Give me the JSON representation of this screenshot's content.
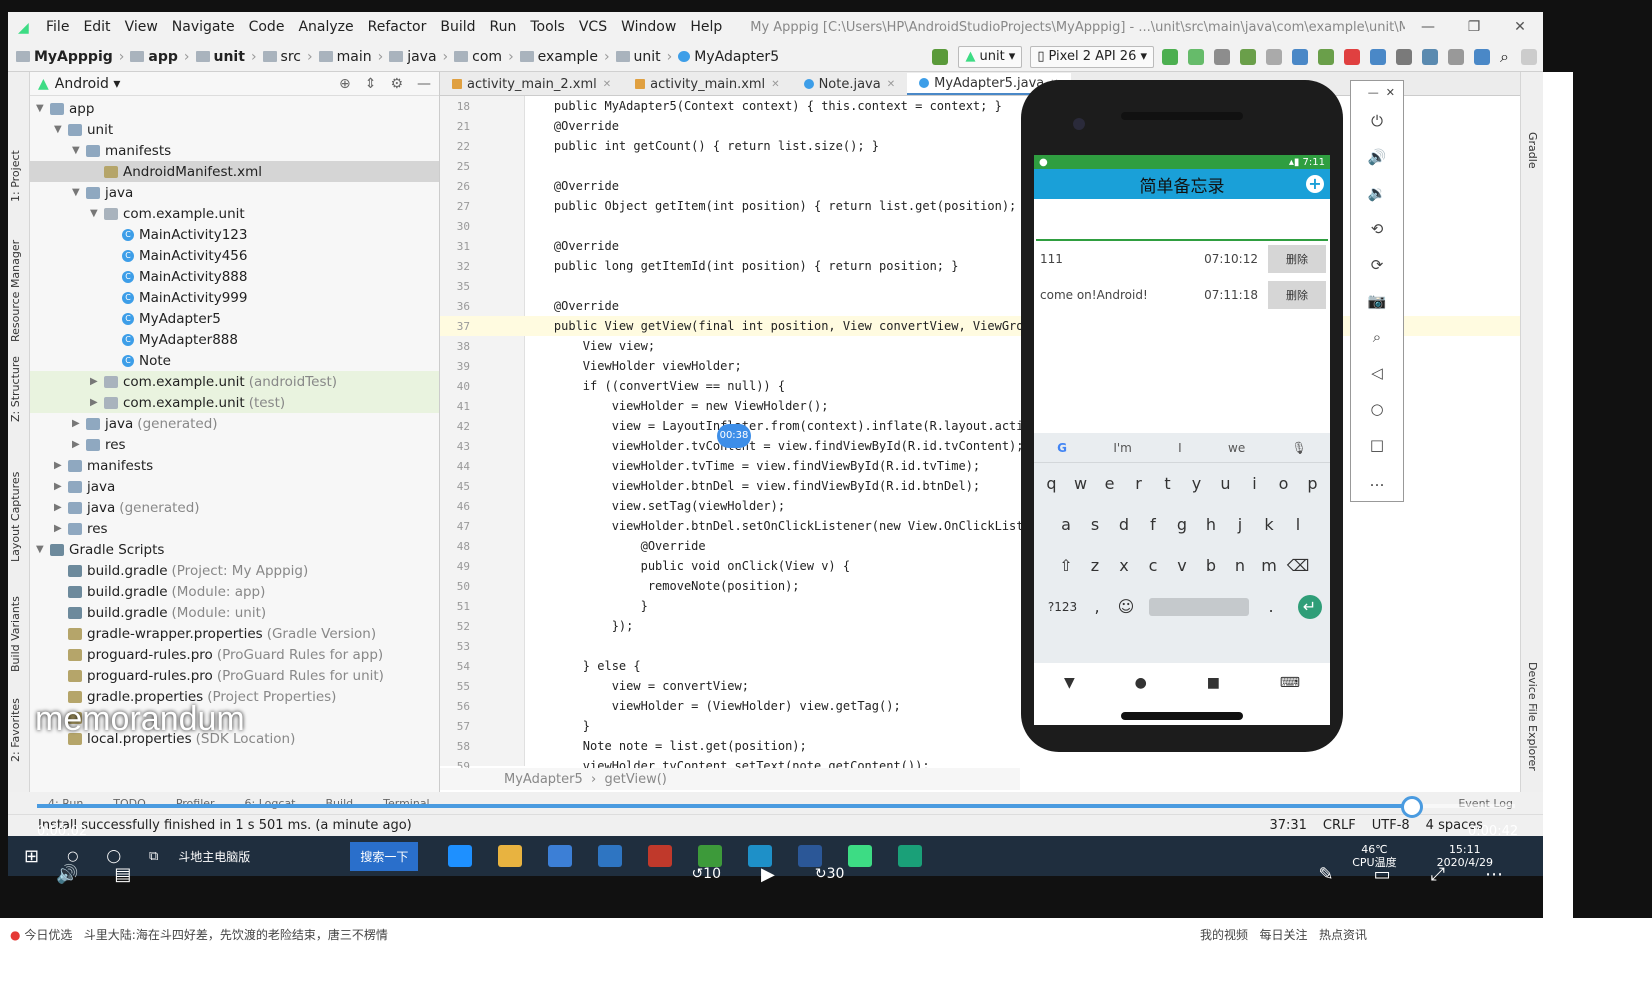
{
  "menu": {
    "items": [
      "File",
      "Edit",
      "View",
      "Navigate",
      "Code",
      "Analyze",
      "Refactor",
      "Build",
      "Run",
      "Tools",
      "VCS",
      "Window",
      "Help"
    ],
    "title": "My Apppig [C:\\Users\\HP\\AndroidStudioProjects\\MyApppig] - ...\\unit\\src\\main\\java\\com\\example\\unit\\MyAdapter5.java [unit]"
  },
  "nav": {
    "crumbs": [
      "MyApppig",
      "app",
      "unit",
      "src",
      "main",
      "java",
      "com",
      "example",
      "unit",
      "MyAdapter5"
    ],
    "config": "unit",
    "device": "Pixel 2 API 26"
  },
  "left_strip": [
    "1: Project",
    "Resource Manager",
    "Z: Structure",
    "Layout Captures",
    "Build Variants",
    "2: Favorites"
  ],
  "project": {
    "view": "Android",
    "tree": [
      {
        "label": "app",
        "d": 0,
        "arrow": "▼",
        "icon": "folder"
      },
      {
        "label": "unit",
        "d": 1,
        "arrow": "▼",
        "icon": "folder"
      },
      {
        "label": "manifests",
        "d": 2,
        "arrow": "▼",
        "icon": "folder"
      },
      {
        "label": "AndroidManifest.xml",
        "d": 3,
        "arrow": "",
        "icon": "file",
        "sel": true
      },
      {
        "label": "java",
        "d": 2,
        "arrow": "▼",
        "icon": "folder"
      },
      {
        "label": "com.example.unit",
        "d": 3,
        "arrow": "▼",
        "icon": "pkg"
      },
      {
        "label": "MainActivity123",
        "d": 4,
        "arrow": "",
        "icon": "class"
      },
      {
        "label": "MainActivity456",
        "d": 4,
        "arrow": "",
        "icon": "class"
      },
      {
        "label": "MainActivity888",
        "d": 4,
        "arrow": "",
        "icon": "class"
      },
      {
        "label": "MainActivity999",
        "d": 4,
        "arrow": "",
        "icon": "class"
      },
      {
        "label": "MyAdapter5",
        "d": 4,
        "arrow": "",
        "icon": "class"
      },
      {
        "label": "MyAdapter888",
        "d": 4,
        "arrow": "",
        "icon": "class"
      },
      {
        "label": "Note",
        "d": 4,
        "arrow": "",
        "icon": "class"
      },
      {
        "label": "com.example.unit",
        "note": "(androidTest)",
        "d": 3,
        "arrow": "▶",
        "icon": "pkg",
        "test": true
      },
      {
        "label": "com.example.unit",
        "note": "(test)",
        "d": 3,
        "arrow": "▶",
        "icon": "pkg",
        "test": true
      },
      {
        "label": "java",
        "note": "(generated)",
        "d": 2,
        "arrow": "▶",
        "icon": "folder"
      },
      {
        "label": "res",
        "d": 2,
        "arrow": "▶",
        "icon": "folder"
      },
      {
        "label": "manifests",
        "d": 1,
        "arrow": "▶",
        "icon": "folder"
      },
      {
        "label": "java",
        "d": 1,
        "arrow": "▶",
        "icon": "folder"
      },
      {
        "label": "java",
        "note": "(generated)",
        "d": 1,
        "arrow": "▶",
        "icon": "folder"
      },
      {
        "label": "res",
        "d": 1,
        "arrow": "▶",
        "icon": "folder"
      },
      {
        "label": "Gradle Scripts",
        "d": 0,
        "arrow": "▼",
        "icon": "gradle"
      },
      {
        "label": "build.gradle",
        "note": "(Project: My Apppig)",
        "d": 1,
        "arrow": "",
        "icon": "gradle"
      },
      {
        "label": "build.gradle",
        "note": "(Module: app)",
        "d": 1,
        "arrow": "",
        "icon": "gradle"
      },
      {
        "label": "build.gradle",
        "note": "(Module: unit)",
        "d": 1,
        "arrow": "",
        "icon": "gradle"
      },
      {
        "label": "gradle-wrapper.properties",
        "note": "(Gradle Version)",
        "d": 1,
        "arrow": "",
        "icon": "file"
      },
      {
        "label": "proguard-rules.pro",
        "note": "(ProGuard Rules for app)",
        "d": 1,
        "arrow": "",
        "icon": "file"
      },
      {
        "label": "proguard-rules.pro",
        "note": "(ProGuard Rules for unit)",
        "d": 1,
        "arrow": "",
        "icon": "file"
      },
      {
        "label": "gradle.properties",
        "note": "(Project Properties)",
        "d": 1,
        "arrow": "",
        "icon": "file"
      },
      {
        "label": "",
        "d": 1,
        "arrow": "",
        "icon": "file"
      },
      {
        "label": "local.properties",
        "note": "(SDK Location)",
        "d": 1,
        "arrow": "",
        "icon": "file"
      }
    ]
  },
  "tabs": [
    "activity_main_2.xml",
    "activity_main.xml",
    "Note.java",
    "MyAdapter5.java"
  ],
  "active_tab": "MyAdapter5.java",
  "code": [
    {
      "n": "18",
      "t": "    public MyAdapter5(Context context) { this.context = context; }"
    },
    {
      "n": "21",
      "t": "    @Override"
    },
    {
      "n": "22",
      "t": "    public int getCount() { return list.size(); }"
    },
    {
      "n": "25",
      "t": ""
    },
    {
      "n": "26",
      "t": "    @Override"
    },
    {
      "n": "27",
      "t": "    public Object getItem(int position) { return list.get(position); }"
    },
    {
      "n": "30",
      "t": ""
    },
    {
      "n": "31",
      "t": "    @Override"
    },
    {
      "n": "32",
      "t": "    public long getItemId(int position) { return position; }"
    },
    {
      "n": "35",
      "t": ""
    },
    {
      "n": "36",
      "t": "    @Override"
    },
    {
      "n": "37",
      "t": "    public View getView(final int position, View convertView, ViewGroup p",
      "hl": true
    },
    {
      "n": "38",
      "t": "        View view;"
    },
    {
      "n": "39",
      "t": "        ViewHolder viewHolder;"
    },
    {
      "n": "40",
      "t": "        if ((convertView == null)) {"
    },
    {
      "n": "41",
      "t": "            viewHolder = new ViewHolder();"
    },
    {
      "n": "42",
      "t": "            view = LayoutInflater.from(context).inflate(R.layout.activity"
    },
    {
      "n": "43",
      "t": "            viewHolder.tvContent = view.findViewById(R.id.tvContent);"
    },
    {
      "n": "44",
      "t": "            viewHolder.tvTime = view.findViewById(R.id.tvTime);"
    },
    {
      "n": "45",
      "t": "            viewHolder.btnDel = view.findViewById(R.id.btnDel);"
    },
    {
      "n": "46",
      "t": "            view.setTag(viewHolder);"
    },
    {
      "n": "47",
      "t": "            viewHolder.btnDel.setOnClickListener(new View.OnClickListener"
    },
    {
      "n": "48",
      "t": "                @Override"
    },
    {
      "n": "49",
      "t": "                public void onClick(View v) {"
    },
    {
      "n": "50",
      "t": "                 removeNote(position);"
    },
    {
      "n": "51",
      "t": "                }"
    },
    {
      "n": "52",
      "t": "            });"
    },
    {
      "n": "53",
      "t": ""
    },
    {
      "n": "54",
      "t": "        } else {"
    },
    {
      "n": "55",
      "t": "            view = convertView;"
    },
    {
      "n": "56",
      "t": "            viewHolder = (ViewHolder) view.getTag();"
    },
    {
      "n": "57",
      "t": "        }"
    },
    {
      "n": "58",
      "t": "        Note note = list.get(position);"
    },
    {
      "n": "59",
      "t": "        viewHolder.tvContent.setText(note.getContent());"
    }
  ],
  "editor_crumb": [
    "MyAdapter5",
    "getView()"
  ],
  "phone": {
    "time": "7:11",
    "app_title": "简单备忘录",
    "notes": [
      {
        "content": "111",
        "time": "07:10:12",
        "del": "删除"
      },
      {
        "content": "come on!Android!",
        "time": "07:11:18",
        "del": "删除"
      }
    ],
    "suggestions": [
      "I'm",
      "I",
      "we"
    ],
    "rows": [
      [
        "q",
        "w",
        "e",
        "r",
        "t",
        "y",
        "u",
        "i",
        "o",
        "p"
      ],
      [
        "a",
        "s",
        "d",
        "f",
        "g",
        "h",
        "j",
        "k",
        "l"
      ],
      [
        "⇧",
        "z",
        "x",
        "c",
        "v",
        "b",
        "n",
        "m",
        "⌫"
      ],
      [
        "?123",
        ",",
        "☺",
        "",
        ".",
        "↵"
      ]
    ]
  },
  "bottom_tools": [
    "4: Run",
    "TODO",
    "Profiler",
    "6: Logcat",
    "Build",
    "Terminal",
    "Event Log"
  ],
  "status": {
    "msg": "Install successfully finished in 1 s 501 ms. (a minute ago)",
    "pos": "37:31",
    "crlf": "CRLF",
    "enc": "UTF-8",
    "indent": "4 spaces"
  },
  "video": {
    "title": "memorandum",
    "elapsed": "0:00:02",
    "total": "0:00:42",
    "progress": 0.93,
    "bubble": "00:38",
    "skip_back": "10",
    "skip_fwd": "30"
  },
  "taskbar": {
    "app": "斗地主电脑版",
    "search": "搜索一下",
    "temp": "46℃",
    "temp_label": "CPU温度",
    "clock": "15:11",
    "date": "2020/4/29"
  },
  "outer": {
    "left": "今日优选",
    "news": "斗里大陆:海在斗四好差，先饮渡的老险结束，唐三不楞情",
    "r1": "我的视频",
    "r2": "每日关注",
    "r3": "热点资讯"
  }
}
